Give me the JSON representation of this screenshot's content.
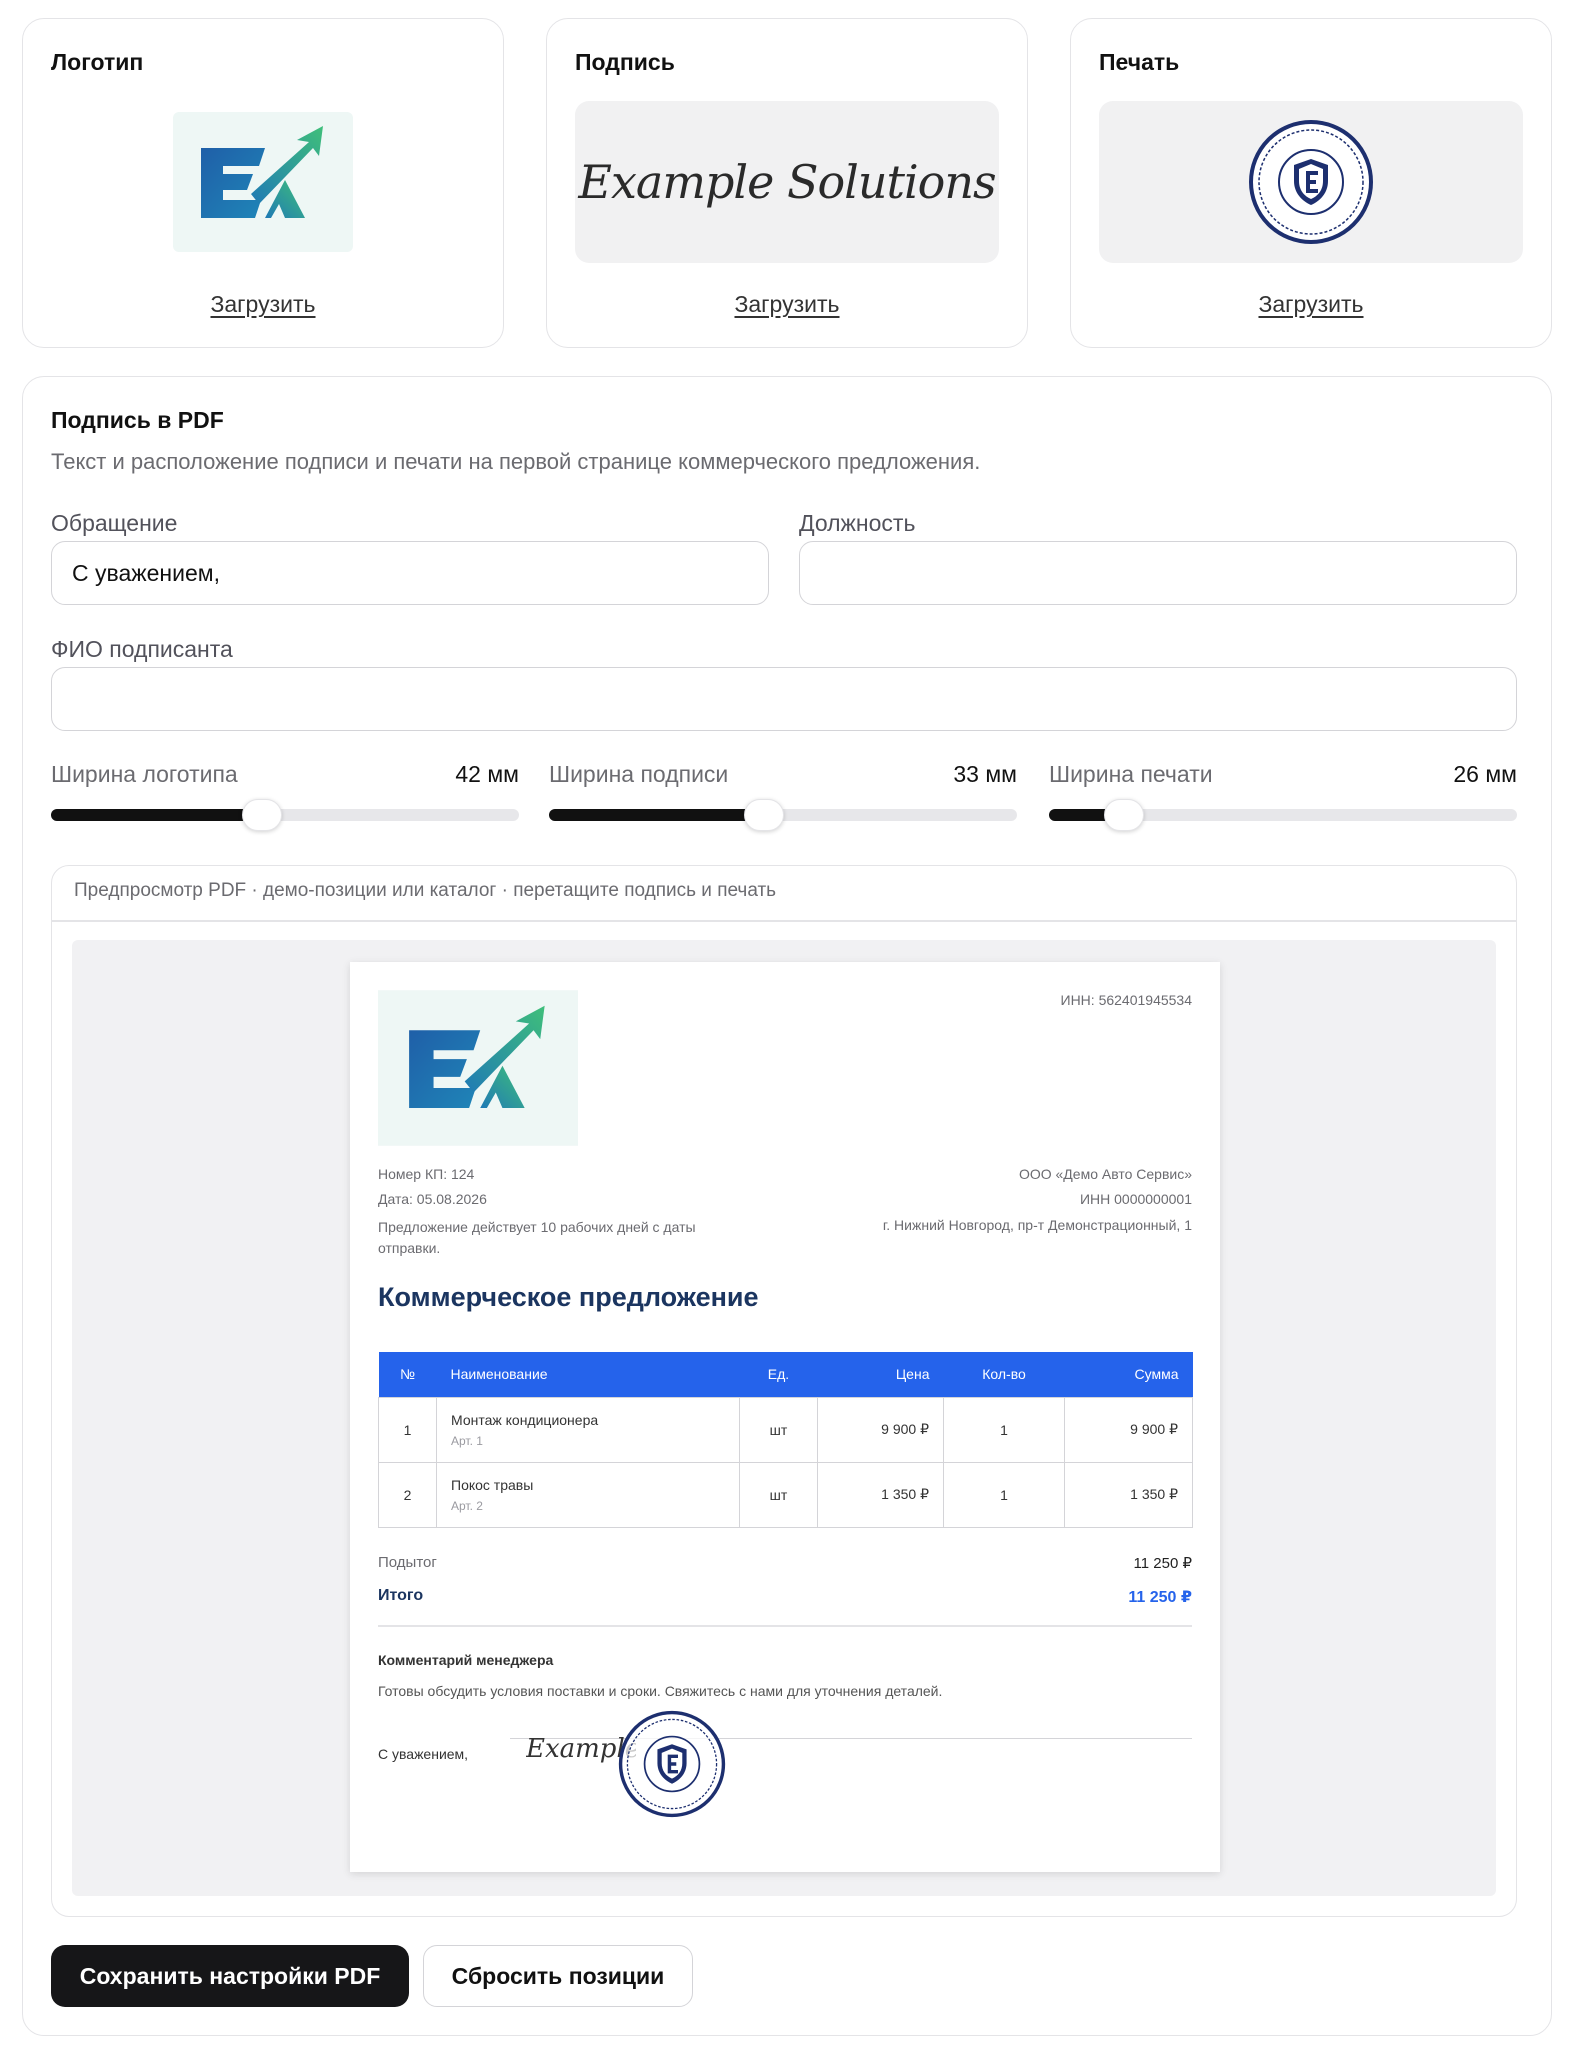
{
  "uploads": [
    {
      "title": "Логотип",
      "action": "Загрузить"
    },
    {
      "title": "Подпись",
      "action": "Загрузить",
      "signature_text": "Example Solutions"
    },
    {
      "title": "Печать",
      "action": "Загрузить"
    }
  ],
  "pdf_settings": {
    "title": "Подпись в PDF",
    "subtitle": "Текст и расположение подписи и печати на первой странице коммерческого предложения.",
    "greeting_label": "Обращение",
    "greeting_value": "С уважением,",
    "position_label": "Должность",
    "position_value": "",
    "signer_label": "ФИО подписанта",
    "signer_value": ""
  },
  "sliders": [
    {
      "label": "Ширина логотипа",
      "value_text": "42 мм",
      "fraction": 0.45
    },
    {
      "label": "Ширина подписи",
      "value_text": "33 мм",
      "fraction": 0.46
    },
    {
      "label": "Ширина печати",
      "value_text": "26 мм",
      "fraction": 0.16
    }
  ],
  "preview": {
    "caption": "Предпросмотр PDF · демо-позиции или каталог · перетащите подпись и печать",
    "inn_top": "ИНН: 562401945534",
    "kp_number": "Номер КП: 124",
    "date": "Дата: 05.08.2026",
    "validity": "Предложение действует 10 рабочих дней с даты отправки.",
    "client_name": "ООО «Демо Авто Сервис»",
    "client_inn": "ИНН 0000000001",
    "client_address": "г. Нижний Новгород, пр-т Демонстрационный, 1",
    "doc_title": "Коммерческое предложение",
    "table_headers": [
      "№",
      "Наименование",
      "Ед.",
      "Цена",
      "Кол-во",
      "Сумма"
    ],
    "rows": [
      {
        "n": "1",
        "name": "Монтаж кондиционера",
        "art": "Арт. 1",
        "unit": "шт",
        "price": "9 900 ₽",
        "qty": "1",
        "sum": "9 900 ₽"
      },
      {
        "n": "2",
        "name": "Покос травы",
        "art": "Арт. 2",
        "unit": "шт",
        "price": "1 350 ₽",
        "qty": "1",
        "sum": "1 350 ₽"
      }
    ],
    "subtotal_label": "Подытог",
    "subtotal_value": "11 250 ₽",
    "total_label": "Итого",
    "total_value": "11 250 ₽",
    "comment_title": "Комментарий менеджера",
    "comment_text": "Готовы обсудить условия поставки и сроки. Свяжитесь с нами для уточнения деталей.",
    "greeting": "С уважением,",
    "signature_text": "Example Solutions"
  },
  "buttons": {
    "save": "Сохранить настройки PDF",
    "reset": "Сбросить позиции"
  },
  "colors": {
    "accent": "#2563eb",
    "title_navy": "#1b3560",
    "dark_button": "#161618"
  }
}
